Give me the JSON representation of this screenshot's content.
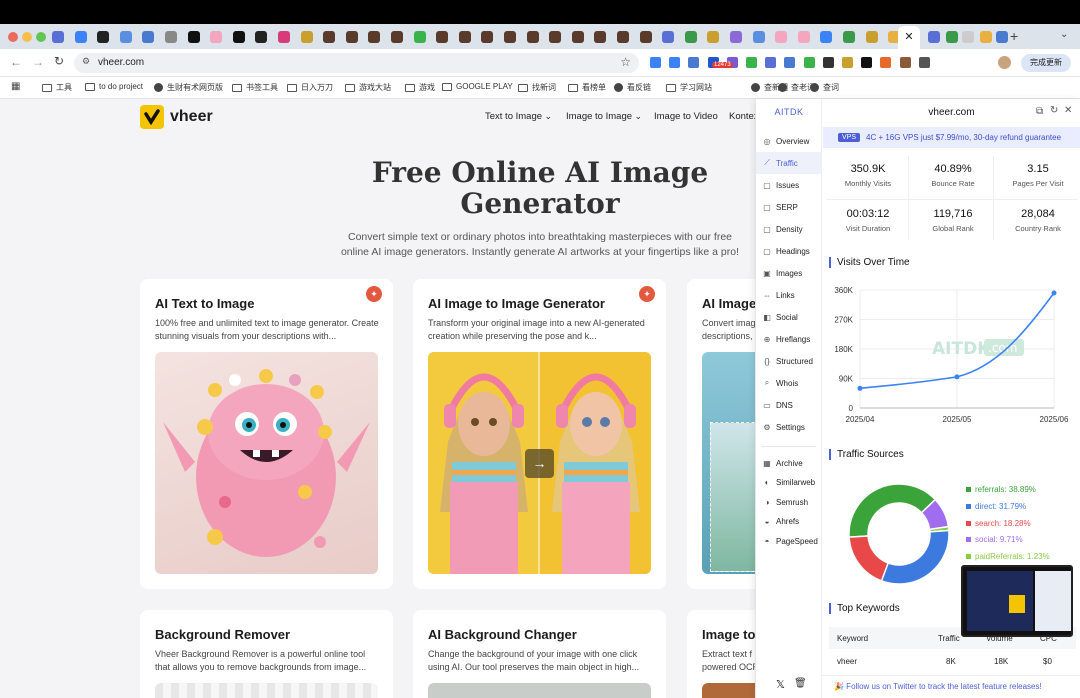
{
  "browser": {
    "url": "vheer.com",
    "update_button": "完成更新",
    "ext_badge": "12473",
    "ext_badge2": "16"
  },
  "bookmarks": [
    {
      "label": "工具",
      "icon": "folder-icon"
    },
    {
      "label": "to do project",
      "icon": "folder-icon"
    },
    {
      "label": "生财有术网页版",
      "icon": "site-icon"
    },
    {
      "label": "书签工具",
      "icon": "folder-icon"
    },
    {
      "label": "日入万刀",
      "icon": "folder-icon"
    },
    {
      "label": "游戏大站",
      "icon": "folder-icon"
    },
    {
      "label": "游戏",
      "icon": "folder-icon"
    },
    {
      "label": "GOOGLE PLAY",
      "icon": "folder-icon"
    },
    {
      "label": "找新词",
      "icon": "folder-icon"
    },
    {
      "label": "看榜单",
      "icon": "folder-icon"
    },
    {
      "label": "看反链",
      "icon": "site-icon"
    },
    {
      "label": "学习网站",
      "icon": "folder-icon"
    },
    {
      "label": "查新词",
      "icon": "site-icon"
    },
    {
      "label": "查老词",
      "icon": "site-icon"
    },
    {
      "label": "查词",
      "icon": "site-icon"
    }
  ],
  "site": {
    "logo_text": "vheer",
    "nav": [
      {
        "label": "Text to Image",
        "dropdown": true
      },
      {
        "label": "Image to Image",
        "dropdown": true
      },
      {
        "label": "Image to Video",
        "dropdown": false
      },
      {
        "label": "Kontex",
        "dropdown": false
      }
    ],
    "hero_title_line1": "Free Online AI Image",
    "hero_title_line2": "Generator",
    "hero_sub_line1": "Convert simple text or ordinary photos into breathtaking masterpieces with our free",
    "hero_sub_line2": "online AI image generators. Instantly generate AI artworks at your fingertips like a pro!",
    "cards": [
      {
        "title": "AI Text to Image",
        "desc": "100% free and unlimited text to image generator. Create stunning visuals from your descriptions with..."
      },
      {
        "title": "AI Image to Image Generator",
        "desc": "Transform your original image into a new AI-generated creation while preserving the pose and k..."
      },
      {
        "title": "AI Image",
        "desc": "Convert imag descriptions,"
      },
      {
        "title": "Background Remover",
        "desc": "Vheer Background Remover is a powerful online tool that allows you to remove backgrounds from image..."
      },
      {
        "title": "AI Background Changer",
        "desc": "Change the background of your image with one click using AI. Our tool preserves the main object in high..."
      },
      {
        "title": "Image to",
        "desc": "Extract text f powered OCR"
      }
    ]
  },
  "panel": {
    "brand": "AITDK",
    "domain": "vheer.com",
    "ad_badge": "VPS",
    "ad_text": "4C + 16G VPS just $7.99/mo, 30-day refund guarantee",
    "nav": [
      "Overview",
      "Traffic",
      "Issues",
      "SERP",
      "Density",
      "Headings",
      "Images",
      "Links",
      "Social",
      "Hreflangs",
      "Structured",
      "Whois",
      "DNS",
      "Settings"
    ],
    "nav_active": "Traffic",
    "tools": [
      "Archive",
      "Similarweb",
      "Semrush",
      "Ahrefs",
      "PageSpeed"
    ],
    "metrics": [
      {
        "value": "350.9K",
        "label": "Monthly Visits"
      },
      {
        "value": "40.89%",
        "label": "Bounce Rate"
      },
      {
        "value": "3.15",
        "label": "Pages Per Visit"
      },
      {
        "value": "00:03:12",
        "label": "Visit Duration"
      },
      {
        "value": "119,716",
        "label": "Global Rank"
      },
      {
        "value": "28,084",
        "label": "Country Rank"
      }
    ],
    "visits_title": "Visits Over Time",
    "sources_title": "Traffic Sources",
    "keywords_title": "Top Keywords",
    "watermark": "AITDK",
    "watermark_suffix": ".com",
    "keyword_headers": [
      "Keyword",
      "Traffic",
      "Volume",
      "CPC"
    ],
    "keyword_rows": [
      {
        "keyword": "vheer",
        "traffic": "8K",
        "volume": "18K",
        "cpc": "$0"
      }
    ],
    "footer_text": "🎉 Follow us on Twitter to track the latest feature releases!"
  },
  "chart_data": [
    {
      "type": "line",
      "title": "Visits Over Time",
      "x": [
        "2025/04",
        "2025/05",
        "2025/06"
      ],
      "series": [
        {
          "values": [
            60000,
            95000,
            350900
          ]
        }
      ],
      "ylim": [
        0,
        360000
      ],
      "yticks": [
        "0",
        "90K",
        "180K",
        "270K",
        "360K"
      ],
      "grid": true,
      "color": "#3b82f6"
    },
    {
      "type": "pie",
      "title": "Traffic Sources",
      "donut": true,
      "slices": [
        {
          "name": "referrals",
          "value": 38.89,
          "label": "referrals: 38.89%",
          "color": "#3aa33a"
        },
        {
          "name": "direct",
          "value": 31.79,
          "label": "direct: 31.79%",
          "color": "#3d7ae0"
        },
        {
          "name": "search",
          "value": 18.28,
          "label": "search: 18.28%",
          "color": "#e84848"
        },
        {
          "name": "social",
          "value": 9.71,
          "label": "social: 9.71%",
          "color": "#a06cf0"
        },
        {
          "name": "paidReferrals",
          "value": 1.23,
          "label": "paidReferrals: 1.23%",
          "color": "#88cc44"
        }
      ],
      "legend": "right"
    }
  ]
}
